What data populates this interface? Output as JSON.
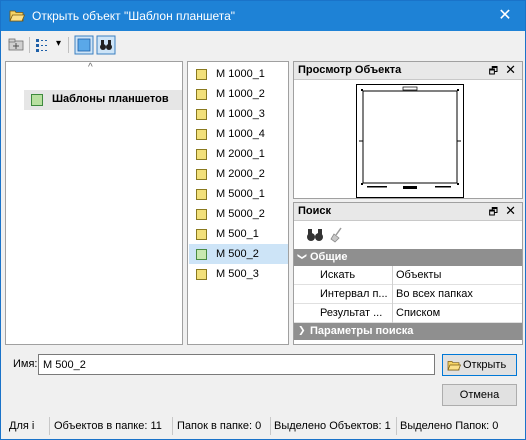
{
  "window": {
    "title": "Открыть объект \"Шаблон планшета\"",
    "close_glyph": "✕"
  },
  "toolbar": {
    "icons": [
      "folder-up-icon",
      "view-mode-icon",
      "dropdown-arrow-icon",
      "preview-toggle-icon",
      "search-binoculars-icon"
    ],
    "view_arrow": "▾"
  },
  "tree": {
    "scroll_glyph": "^",
    "items": [
      {
        "label": "Шаблоны планшетов",
        "selected": true
      }
    ]
  },
  "list": {
    "items": [
      {
        "label": "М 1000_1"
      },
      {
        "label": "М 1000_2"
      },
      {
        "label": "М 1000_3"
      },
      {
        "label": "М 1000_4"
      },
      {
        "label": "М 2000_1"
      },
      {
        "label": "М 2000_2"
      },
      {
        "label": "М 5000_1"
      },
      {
        "label": "М 5000_2"
      },
      {
        "label": "М 500_1"
      },
      {
        "label": "М 500_2",
        "selected": true
      },
      {
        "label": "М 500_3"
      }
    ]
  },
  "preview": {
    "title": "Просмотр Объекта",
    "dock_glyph": "🗗",
    "close_glyph": "✕"
  },
  "search": {
    "title": "Поиск",
    "dock_glyph": "🗗",
    "close_glyph": "✕",
    "group_general": "Общие",
    "group_general_arrow": "❯",
    "rows": [
      {
        "key": "Искать",
        "value": "Объекты"
      },
      {
        "key": "Интервал п...",
        "value": "Во всех папках"
      },
      {
        "key": "Результат ...",
        "value": "Списком"
      }
    ],
    "group_params": "Параметры поиска",
    "group_params_arrow": "❯"
  },
  "footer": {
    "name_label": "Имя:",
    "name_value": "М 500_2",
    "open_label": "Открыть",
    "cancel_label": "Отмена"
  },
  "status": {
    "items": [
      "Для і",
      "Объектов в папке: 11",
      "Папок в папке: 0",
      "Выделено Объектов: 1",
      "Выделено Папок: 0"
    ]
  },
  "colors": {
    "title_bar": "#1e82d6",
    "selection": "#cde4f7",
    "group_header": "#8f8f8f"
  }
}
